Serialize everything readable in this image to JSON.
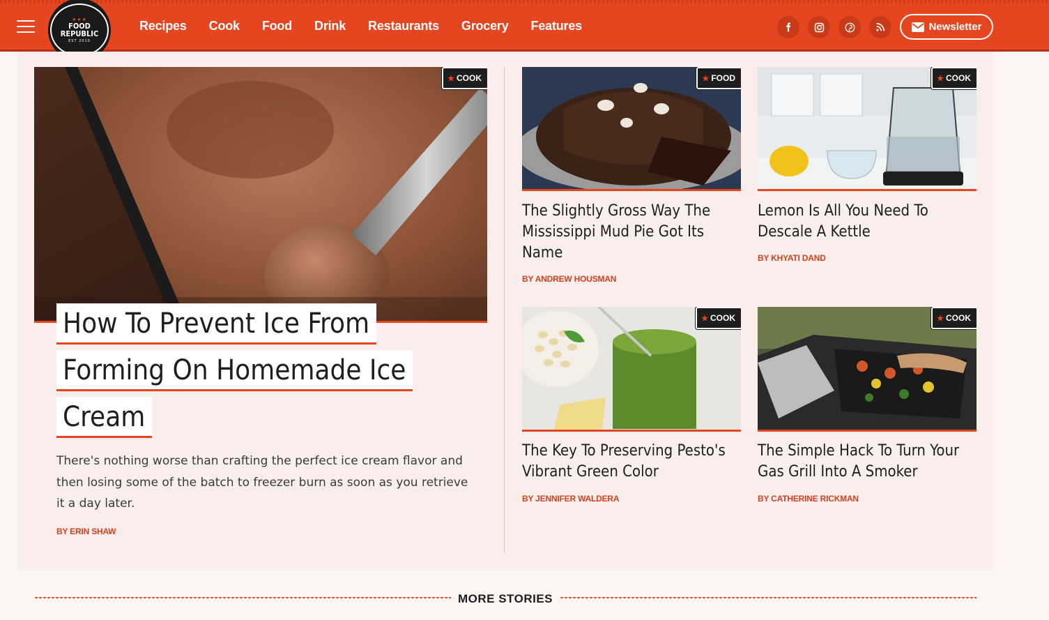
{
  "header": {
    "logo": {
      "line1": "FOOD",
      "line2": "REPUBLIC",
      "est": "EST 2010",
      "stars": "★★★"
    },
    "nav": [
      "Recipes",
      "Cook",
      "Food",
      "Drink",
      "Restaurants",
      "Grocery",
      "Features"
    ],
    "social": [
      "facebook-icon",
      "instagram-icon",
      "pinterest-icon",
      "rss-icon"
    ],
    "newsletter_label": "Newsletter"
  },
  "feature": {
    "tag": "COOK",
    "title_lines": [
      "How To Prevent Ice From",
      "Forming On Homemade Ice",
      "Cream"
    ],
    "description": "There's nothing worse than crafting the perfect ice cream flavor and then losing some of the batch to freezer burn as soon as you retrieve it a day later.",
    "byline": "BY ERIN SHAW"
  },
  "cards": [
    {
      "tag": "FOOD",
      "title": "The Slightly Gross Way The Mississippi Mud Pie Got Its Name",
      "byline": "BY ANDREW HOUSMAN"
    },
    {
      "tag": "COOK",
      "title": "Lemon Is All You Need To Descale A Kettle",
      "byline": "BY KHYATI DAND"
    },
    {
      "tag": "COOK",
      "title": "The Key To Preserving Pesto's Vibrant Green Color",
      "byline": "BY JENNIFER WALDERA"
    },
    {
      "tag": "COOK",
      "title": "The Simple Hack To Turn Your Gas Grill Into A Smoker",
      "byline": "BY CATHERINE RICKMAN"
    }
  ],
  "more_stories": "MORE STORIES",
  "colors": {
    "brand": "#e6461f",
    "dark": "#1e1e1e",
    "panel": "#faeeec"
  }
}
